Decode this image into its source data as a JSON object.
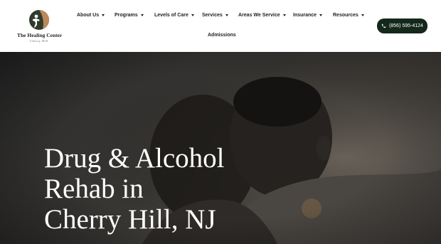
{
  "logo": {
    "title": "The Healing Center",
    "subtitle": "Cherry Hill",
    "colors": {
      "figure": "#2f3b2c",
      "accent": "#b9895a"
    }
  },
  "nav": {
    "items": [
      {
        "label": "About Us",
        "has_dropdown": true
      },
      {
        "label": "Programs",
        "has_dropdown": true
      },
      {
        "label": "Levels of Care",
        "has_dropdown": true
      },
      {
        "label": "Services",
        "has_dropdown": true
      },
      {
        "label": "Areas We Service",
        "has_dropdown": true
      },
      {
        "label": "Insurance",
        "has_dropdown": true
      },
      {
        "label": "Resources",
        "has_dropdown": true
      },
      {
        "label": "Admissions",
        "has_dropdown": false
      }
    ]
  },
  "phone_button": {
    "label": "(856) 595-4124",
    "icon": "phone-icon",
    "color": "#14281b"
  },
  "hero": {
    "title_lines": [
      "Drug & Alcohol",
      "Rehab in",
      "Cherry Hill, NJ"
    ]
  }
}
